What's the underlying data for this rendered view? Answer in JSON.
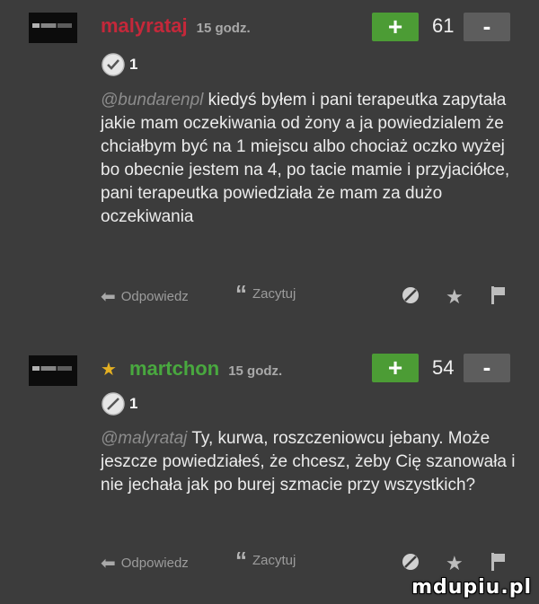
{
  "comments": [
    {
      "author": "malyrataj",
      "time": "15 godz.",
      "score": "61",
      "plus_label": "+",
      "minus_label": "-",
      "badge_count": "1",
      "mention": "@bundarenpl",
      "text": "kiedyś byłem i pani terapeutka zapytała jakie mam oczekiwania od żony a ja powiedzialem że chciałbym być na 1 miejscu albo chociaż oczko wyżej bo obecnie jestem na 4, po tacie mamie i przyjaciółce, pani terapeutka powiedziała że mam za dużo oczekiwania",
      "reply_label": "Odpowiedz",
      "quote_label": "Zacytuj"
    },
    {
      "author": "martchon",
      "time": "15 godz.",
      "score": "54",
      "plus_label": "+",
      "minus_label": "-",
      "badge_count": "1",
      "mention": "@malyrataj",
      "text": "Ty, kurwa, roszczeniowcu jebany. Może jeszcze powiedziałeś, że chcesz, żeby Cię szanowała i nie jechała jak po burej szmacie przy wszystkich?",
      "reply_label": "Odpowiedz",
      "quote_label": "Zacytuj"
    }
  ],
  "icons": {
    "reply": "reply-arrow-icon",
    "quote": "quote-icon",
    "block": "block-icon",
    "favorite": "star-icon",
    "report": "flag-icon"
  },
  "colors": {
    "background": "#3c3c3c",
    "author_red": "#c4283a",
    "author_green": "#49a83f",
    "plus_button": "#4c9c35",
    "minus_button": "#5d5d5d"
  },
  "watermark": "mdupiu.pl"
}
